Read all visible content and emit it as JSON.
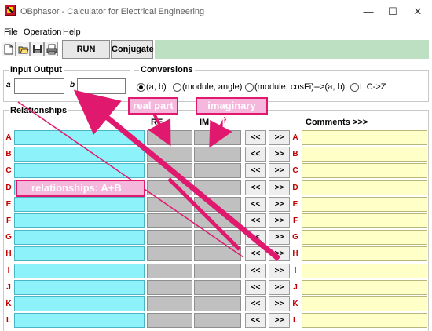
{
  "window": {
    "title": "OBphasor - Calculator for Electrical Engineering",
    "minimize_glyph": "—",
    "maximize_glyph": "☐",
    "close_glyph": "✕"
  },
  "menu": [
    "File",
    "Operation",
    "Help"
  ],
  "toolbar": {
    "icons": [
      "new-document-icon",
      "open-folder-icon",
      "save-disk-icon",
      "print-icon"
    ],
    "run_label": "RUN",
    "conjugate_label": "Conjugate"
  },
  "input_output": {
    "label": "Input Output",
    "a_label": "a",
    "b_label": "b",
    "a_value": "",
    "b_value": ""
  },
  "conversions": {
    "label": "Conversions",
    "options": [
      "(a, b)",
      "(module, angle)",
      "(module, cosFi)-->(a, b)",
      "L C->Z"
    ],
    "selected_index": 0
  },
  "grid": {
    "relationships_label": "Relationships",
    "re_label": "RE",
    "im_label": "IM",
    "comments_label": "Comments >>>",
    "left_button": "<<",
    "right_button": ">>",
    "rows": [
      "A",
      "B",
      "C",
      "D",
      "E",
      "F",
      "G",
      "H",
      "I",
      "J",
      "K",
      "L"
    ]
  },
  "annotations": {
    "real_part": "real part",
    "imaginary_part": "imaginary part",
    "relationships": "relationships: A+B"
  },
  "colors": {
    "relationship_cell": "#8ef2fb",
    "result_cell": "#c0c0c0",
    "comment_cell": "#ffffc8",
    "row_letter": "#c00000",
    "annotation_border": "#e0196e",
    "annotation_fill": "#f6b7dd",
    "status_bar": "#bde0c2"
  }
}
